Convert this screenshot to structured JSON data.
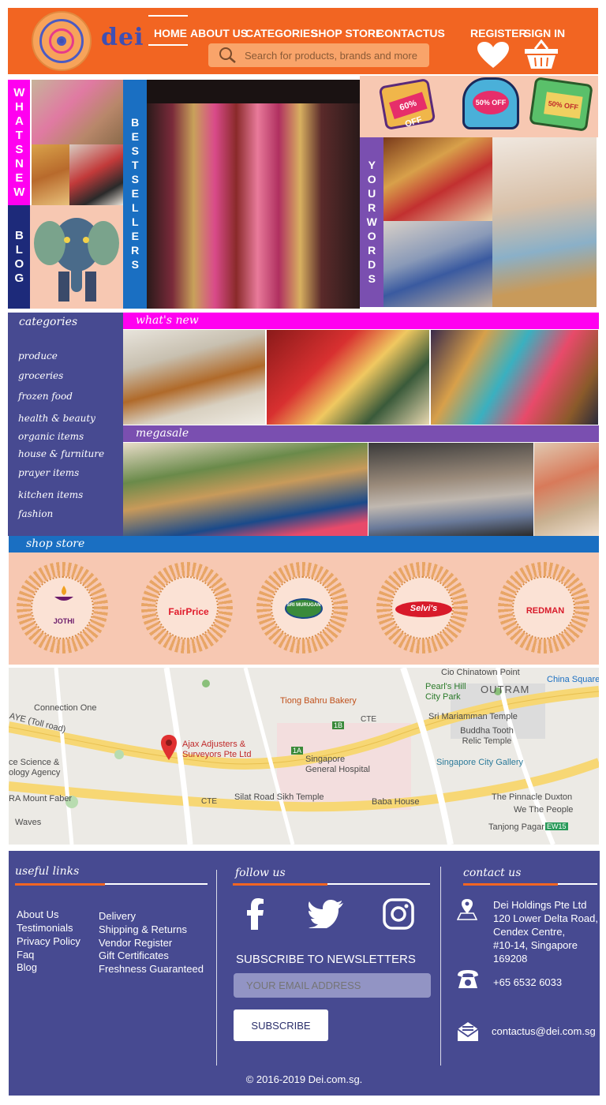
{
  "brand": {
    "logo_text": "dei"
  },
  "nav": {
    "items": [
      {
        "label": "HOME",
        "active": true
      },
      {
        "label": "ABOUT US"
      },
      {
        "label": "CATEGORIES"
      },
      {
        "label": "SHOP STORE"
      },
      {
        "label": "CONTACTUS"
      }
    ]
  },
  "search": {
    "placeholder": "Search for products, brands and more"
  },
  "account": {
    "register_label": "REGISTER",
    "signin_label": "SIGN IN"
  },
  "tiles": {
    "whats_new": "WHATSNEW",
    "blog": "BLOG",
    "best_sellers": "BESTSELLERS",
    "your_words": "YOURWORDS",
    "sale_badges": [
      "60% OFF",
      "50% OFF",
      "50% OFF"
    ]
  },
  "categories": {
    "title": "categories",
    "items": [
      "produce",
      "groceries",
      "frozen food",
      "health & beauty",
      "organic items",
      "house & furniture",
      "prayer items",
      "kitchen items",
      "fashion"
    ]
  },
  "sections": {
    "whats_new": "what's new",
    "megasale": "megasale",
    "shop_store": "shop store"
  },
  "stores": [
    "JOTHI",
    "FairPrice",
    "SRI MURUGAN",
    "Selvi's",
    "REDMAN"
  ],
  "map": {
    "pin_label": "Ajax Adjusters & Surveyors Pte Ltd",
    "labels": [
      "Cio Chinatown Point",
      "China Square",
      "Pearl's Hill City Park",
      "OUTRAM",
      "Tiong Bahru Bakery",
      "Connection One",
      "Sri Mariamman Temple",
      "Buddha Tooth Relic Temple",
      "AYE (Toll road)",
      "Singapore General Hospital",
      "Singapore City Gallery",
      "ce Science & ology Agency",
      "Silat Road Sikh Temple",
      "Baba House",
      "The Pinnacle Duxton",
      "We The People",
      "RA Mount Faber",
      "Waves",
      "Tanjong Pagar",
      "CTE",
      "CTE",
      "1B",
      "1A",
      "EW15"
    ]
  },
  "footer": {
    "useful_links_title": "useful links",
    "links_col1": [
      "About Us",
      "Testimonials",
      "Privacy Policy",
      "Faq",
      "Blog"
    ],
    "links_col2": [
      "Delivery",
      "Shipping & Returns",
      "Vendor Register",
      "Gift Certificates",
      "Freshness Guaranteed"
    ],
    "follow_title": "follow us",
    "social": [
      "facebook-icon",
      "twitter-icon",
      "instagram-icon"
    ],
    "newsletter_title": "SUBSCRIBE TO NEWSLETTERS",
    "email_placeholder": "YOUR EMAIL ADDRESS",
    "subscribe_label": "SUBSCRIBE",
    "contact_title": "contact us",
    "address": [
      "Dei Holdings Pte Ltd",
      "120 Lower Delta Road,",
      "Cendex Centre,",
      "#10-14, Singapore",
      "169208"
    ],
    "phone": "+65 6532 6033",
    "email": "contactus@dei.com.sg",
    "copyright": "© 2016-2019 Dei.com.sg."
  },
  "colors": {
    "orange": "#f26522",
    "navy": "#474a91",
    "magenta": "#ff00f0",
    "purple": "#7a4fb0",
    "blue": "#1a6fc2",
    "peach": "#f7c8b2"
  }
}
